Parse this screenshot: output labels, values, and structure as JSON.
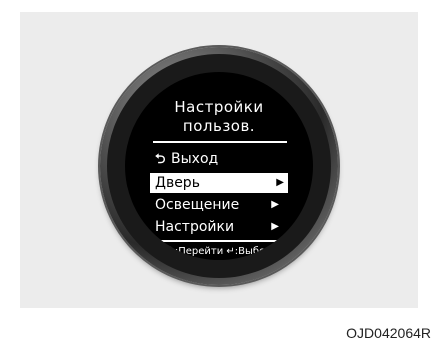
{
  "screen": {
    "title_line1": "Настройки",
    "title_line2": "пользов.",
    "back_label": "Выход",
    "menu_items": [
      {
        "label": "Дверь",
        "selected": true
      },
      {
        "label": "Освещение",
        "selected": false
      },
      {
        "label": "Настройки",
        "selected": false
      }
    ],
    "hint": {
      "navigate_label": "Перейти",
      "select_label": "Выбор"
    }
  },
  "caption": "OJD042064R",
  "icons": {
    "back": "return-arrow-icon",
    "submenu": "triangle-right-icon",
    "navigate": "up-down-arrows-icon",
    "enter": "enter-arrow-icon"
  },
  "colors": {
    "screen_bg": "#000000",
    "text": "#ffffff",
    "highlight_bg": "#ffffff",
    "panel_bg": "#ececec"
  }
}
